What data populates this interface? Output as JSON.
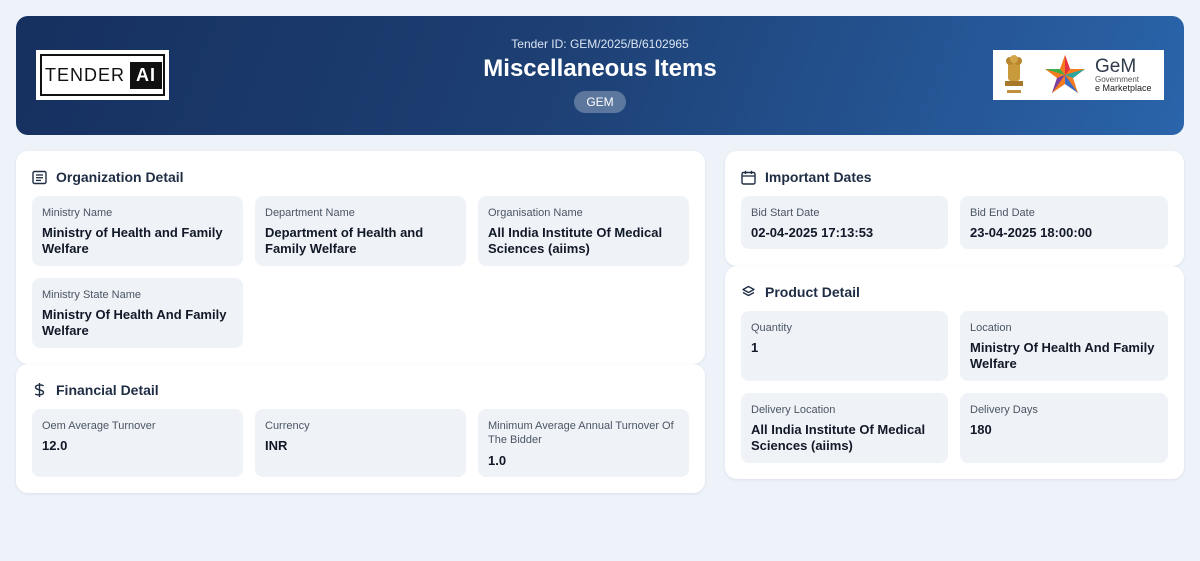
{
  "header": {
    "logo_left": {
      "text": "TENDER",
      "accent": "AI"
    },
    "tender_id": "Tender ID: GEM/2025/B/6102965",
    "title": "Miscellaneous Items",
    "badge": "GEM",
    "logo_right": {
      "brand": "GeM",
      "line1": "Government",
      "line2": "e Marketplace"
    }
  },
  "organization": {
    "title": "Organization Detail",
    "icon": "list-icon",
    "fields": [
      {
        "label": "Ministry Name",
        "value": "Ministry of Health and Family Welfare"
      },
      {
        "label": "Department Name",
        "value": "Department of Health and Family Welfare"
      },
      {
        "label": "Organisation Name",
        "value": "All India Institute Of Medical Sciences (aiims)"
      },
      {
        "label": "Ministry State Name",
        "value": "Ministry Of Health And Family Welfare"
      }
    ]
  },
  "financial": {
    "title": "Financial Detail",
    "icon": "dollar-icon",
    "fields": [
      {
        "label": "Oem Average Turnover",
        "value": "12.0"
      },
      {
        "label": "Currency",
        "value": "INR"
      },
      {
        "label": "Minimum Average Annual Turnover Of The Bidder",
        "value": "1.0"
      }
    ]
  },
  "dates": {
    "title": "Important Dates",
    "icon": "calendar-icon",
    "fields": [
      {
        "label": "Bid Start Date",
        "value": "02-04-2025 17:13:53"
      },
      {
        "label": "Bid End Date",
        "value": "23-04-2025 18:00:00"
      }
    ]
  },
  "product": {
    "title": "Product Detail",
    "icon": "layers-icon",
    "fields": [
      {
        "label": "Quantity",
        "value": "1"
      },
      {
        "label": "Location",
        "value": "Ministry Of Health And Family Welfare"
      },
      {
        "label": "Delivery Location",
        "value": "All India Institute Of Medical Sciences (aiims)"
      },
      {
        "label": "Delivery Days",
        "value": "180"
      }
    ]
  },
  "colors": {
    "header_start": "#16305f",
    "header_end": "#2a64aa",
    "page_bg": "#eef2f9",
    "field_bg": "#eff2f7"
  }
}
